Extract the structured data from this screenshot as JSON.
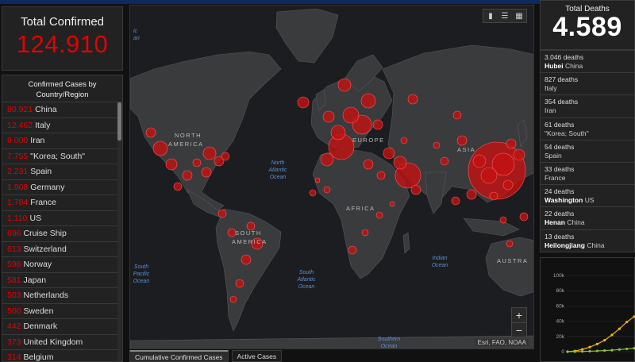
{
  "total_confirmed": {
    "label": "Total Confirmed",
    "value": "124.910"
  },
  "country_list": {
    "header": "Confirmed Cases by Country/Region",
    "items": [
      {
        "count": "80.921",
        "country": "China"
      },
      {
        "count": "12.462",
        "country": "Italy"
      },
      {
        "count": "9.000",
        "country": "Iran"
      },
      {
        "count": "7.755",
        "country": "\"Korea; South\""
      },
      {
        "count": "2.231",
        "country": "Spain"
      },
      {
        "count": "1.908",
        "country": "Germany"
      },
      {
        "count": "1.784",
        "country": "France"
      },
      {
        "count": "1.110",
        "country": "US"
      },
      {
        "count": "696",
        "country": "Cruise Ship"
      },
      {
        "count": "613",
        "country": "Switzerland"
      },
      {
        "count": "598",
        "country": "Norway"
      },
      {
        "count": "581",
        "country": "Japan"
      },
      {
        "count": "503",
        "country": "Netherlands"
      },
      {
        "count": "500",
        "country": "Sweden"
      },
      {
        "count": "442",
        "country": "Denmark"
      },
      {
        "count": "373",
        "country": "United Kingdom"
      },
      {
        "count": "314",
        "country": "Belgium"
      }
    ]
  },
  "map": {
    "labels": {
      "north_america": [
        "NORTH",
        "AMERICA"
      ],
      "south_america": [
        "SOUTH",
        "AMERICA"
      ],
      "europe": "EUROPE",
      "asia": "ASIA",
      "africa": "AFRICA",
      "australia": "AUSTRA",
      "north_atlantic": [
        "North",
        "Atlantic",
        "Ocean"
      ],
      "south_atlantic": [
        "South",
        "Atlantic",
        "Ocean"
      ],
      "south_pacific": [
        "South",
        "Pacific",
        "Ocean"
      ],
      "indian": [
        "Indian",
        "Ocean"
      ],
      "southern": [
        "Southern",
        "Ocean"
      ],
      "pacific_edge": [
        "ic",
        "an"
      ]
    },
    "attribution": "Esri, FAO, NOAA",
    "zoom_in": "+",
    "zoom_out": "−",
    "tools": [
      "bookmark-icon",
      "list-icon",
      "grid-icon"
    ]
  },
  "tabs": [
    {
      "label": "Cumulative Confirmed Cases",
      "active": true
    },
    {
      "label": "Active Cases",
      "active": false
    }
  ],
  "total_deaths": {
    "label": "Total Deaths",
    "value": "4.589"
  },
  "death_list": [
    {
      "deaths": "3.046 deaths",
      "region": "Hubei",
      "country": "China"
    },
    {
      "deaths": "827 deaths",
      "region": "",
      "country": "Italy"
    },
    {
      "deaths": "354 deaths",
      "region": "",
      "country": "Iran"
    },
    {
      "deaths": "61 deaths",
      "region": "",
      "country": "\"Korea; South\""
    },
    {
      "deaths": "54 deaths",
      "region": "",
      "country": "Spain"
    },
    {
      "deaths": "33 deaths",
      "region": "",
      "country": "France"
    },
    {
      "deaths": "24 deaths",
      "region": "Washington",
      "country": "US"
    },
    {
      "deaths": "22 deaths",
      "region": "Henan",
      "country": "China"
    },
    {
      "deaths": "13 deaths",
      "region": "Heilongjiang",
      "country": "China"
    }
  ],
  "chart_data": {
    "type": "line",
    "yticks": [
      "100k",
      "80k",
      "60k",
      "40k",
      "20k",
      "0"
    ],
    "ylim": [
      0,
      100000
    ],
    "series": [
      {
        "color": "#f2b705",
        "values": [
          0,
          1000,
          3000,
          6000,
          10000,
          15000,
          22000,
          30000,
          39000,
          46000
        ]
      },
      {
        "color": "#8bc34a",
        "values": [
          0,
          100,
          300,
          600,
          1000,
          1500,
          2000,
          2800,
          3600,
          4500
        ]
      }
    ],
    "colors": {
      "accent_red": "#e60000",
      "bubble_red": "#c41212"
    }
  }
}
